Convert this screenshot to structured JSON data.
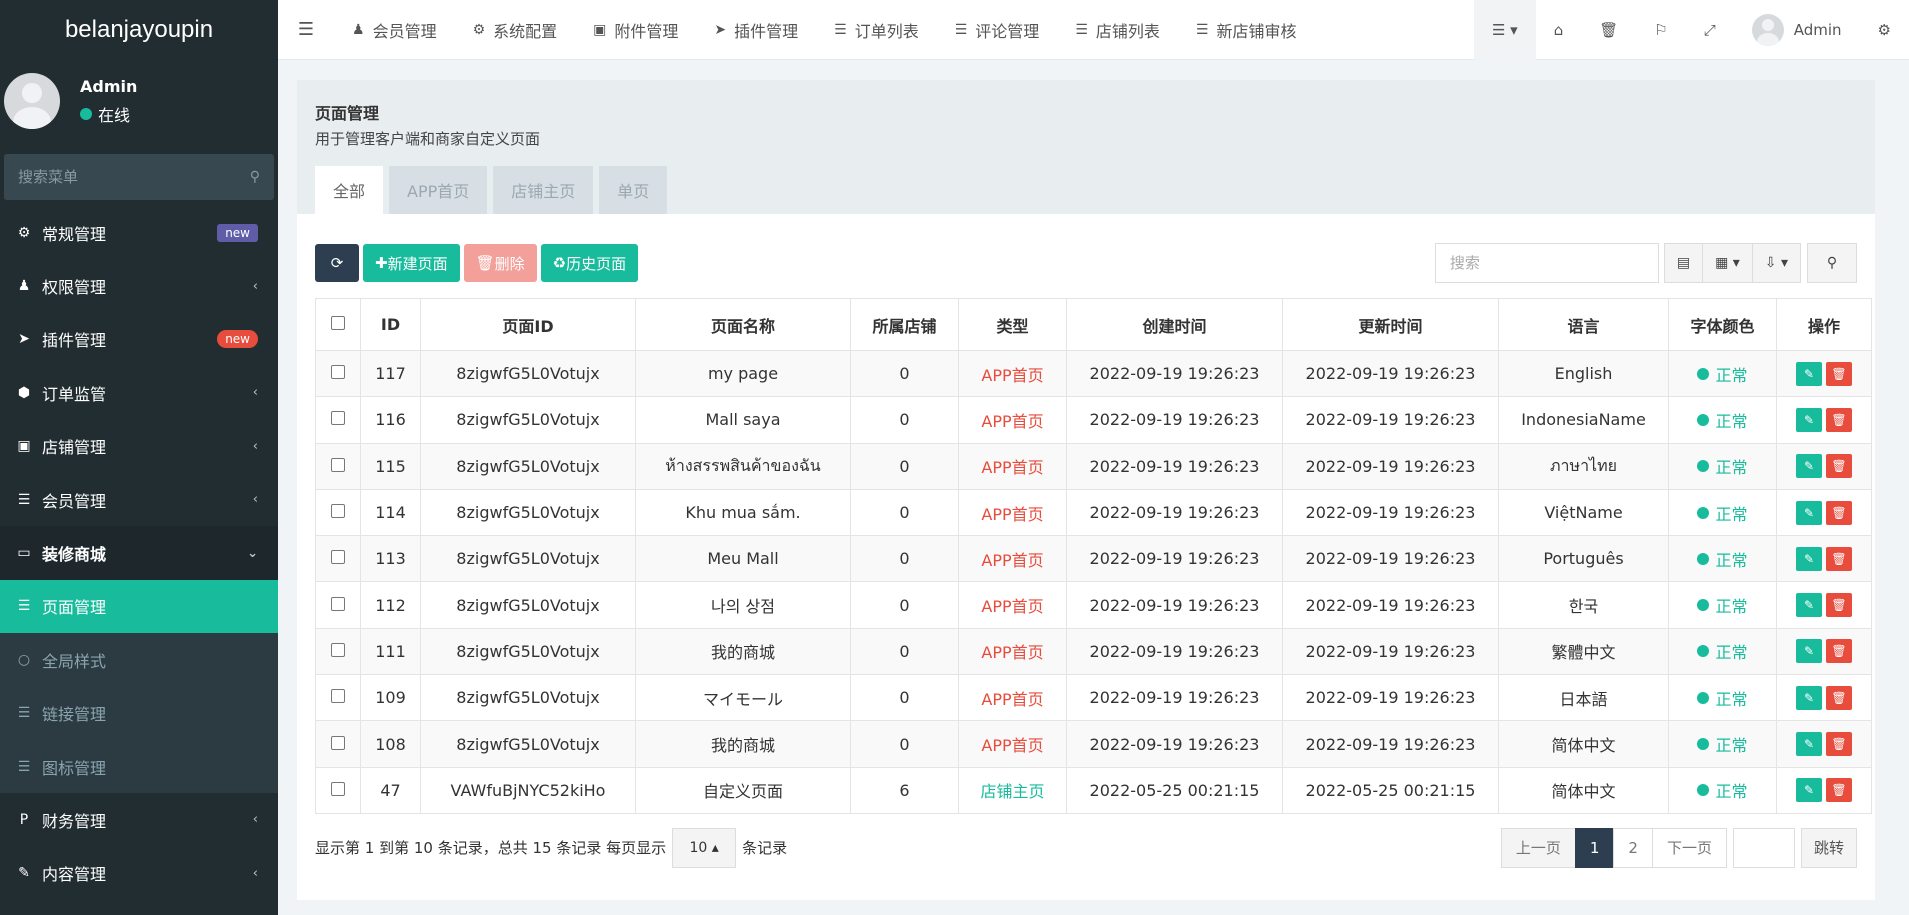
{
  "brand": "belanjayoupin",
  "user": {
    "name": "Admin",
    "status": "在线"
  },
  "sidebar": {
    "search_placeholder": "搜索菜单",
    "items": [
      {
        "label": "常规管理",
        "icon": "cogs-icon",
        "badge": "new"
      },
      {
        "label": "权限管理",
        "icon": "group-icon"
      },
      {
        "label": "插件管理",
        "icon": "rocket-icon",
        "badge": "new"
      },
      {
        "label": "订单监管",
        "icon": "cube-icon"
      },
      {
        "label": "店铺管理",
        "icon": "archive-icon"
      },
      {
        "label": "会员管理",
        "icon": "list-icon"
      },
      {
        "label": "装修商城",
        "icon": "desktop-icon"
      }
    ],
    "sub_items": [
      {
        "label": "页面管理",
        "icon": "list-icon"
      },
      {
        "label": "全局样式",
        "icon": "circle-icon"
      },
      {
        "label": "链接管理",
        "icon": "list-icon"
      },
      {
        "label": "图标管理",
        "icon": "list-icon"
      }
    ],
    "bottom_items": [
      {
        "label": "财务管理",
        "icon": "paypal-icon"
      },
      {
        "label": "内容管理",
        "icon": "edit-icon"
      }
    ]
  },
  "navbar": {
    "links": [
      {
        "label": "会员管理",
        "icon": "user-icon"
      },
      {
        "label": "系统配置",
        "icon": "cog-icon"
      },
      {
        "label": "附件管理",
        "icon": "image-icon"
      },
      {
        "label": "插件管理",
        "icon": "rocket-icon"
      },
      {
        "label": "订单列表",
        "icon": "list-icon"
      },
      {
        "label": "评论管理",
        "icon": "list-icon"
      },
      {
        "label": "店铺列表",
        "icon": "list-icon"
      },
      {
        "label": "新店铺审核",
        "icon": "list-icon"
      }
    ],
    "admin": "Admin"
  },
  "panel": {
    "title": "页面管理",
    "subtitle": "用于管理客户端和商家自定义页面",
    "tabs": [
      "全部",
      "APP首页",
      "店铺主页",
      "单页"
    ]
  },
  "toolbar": {
    "new_label": "新建页面",
    "delete_label": "删除",
    "history_label": "历史页面",
    "search_placeholder": "搜索"
  },
  "table": {
    "headers": [
      "ID",
      "页面ID",
      "页面名称",
      "所属店铺",
      "类型",
      "创建时间",
      "更新时间",
      "语言",
      "字体颜色",
      "操作"
    ],
    "rows": [
      {
        "id": "117",
        "page_id": "8zigwfG5L0Votujx",
        "name": "my page",
        "store": "0",
        "type": "APP首页",
        "created": "2022-09-19 19:26:23",
        "updated": "2022-09-19 19:26:23",
        "lang": "English",
        "color": "正常"
      },
      {
        "id": "116",
        "page_id": "8zigwfG5L0Votujx",
        "name": "Mall saya",
        "store": "0",
        "type": "APP首页",
        "created": "2022-09-19 19:26:23",
        "updated": "2022-09-19 19:26:23",
        "lang": "IndonesiaName",
        "color": "正常"
      },
      {
        "id": "115",
        "page_id": "8zigwfG5L0Votujx",
        "name": "ห้างสรรพสินค้าของฉัน",
        "store": "0",
        "type": "APP首页",
        "created": "2022-09-19 19:26:23",
        "updated": "2022-09-19 19:26:23",
        "lang": "ภาษาไทย",
        "color": "正常"
      },
      {
        "id": "114",
        "page_id": "8zigwfG5L0Votujx",
        "name": "Khu mua sắm.",
        "store": "0",
        "type": "APP首页",
        "created": "2022-09-19 19:26:23",
        "updated": "2022-09-19 19:26:23",
        "lang": "ViệtName",
        "color": "正常"
      },
      {
        "id": "113",
        "page_id": "8zigwfG5L0Votujx",
        "name": "Meu Mall",
        "store": "0",
        "type": "APP首页",
        "created": "2022-09-19 19:26:23",
        "updated": "2022-09-19 19:26:23",
        "lang": "Português",
        "color": "正常"
      },
      {
        "id": "112",
        "page_id": "8zigwfG5L0Votujx",
        "name": "나의 상점",
        "store": "0",
        "type": "APP首页",
        "created": "2022-09-19 19:26:23",
        "updated": "2022-09-19 19:26:23",
        "lang": "한국",
        "color": "正常"
      },
      {
        "id": "111",
        "page_id": "8zigwfG5L0Votujx",
        "name": "我的商城",
        "store": "0",
        "type": "APP首页",
        "created": "2022-09-19 19:26:23",
        "updated": "2022-09-19 19:26:23",
        "lang": "繁體中文",
        "color": "正常"
      },
      {
        "id": "109",
        "page_id": "8zigwfG5L0Votujx",
        "name": "マイモール",
        "store": "0",
        "type": "APP首页",
        "created": "2022-09-19 19:26:23",
        "updated": "2022-09-19 19:26:23",
        "lang": "日本語",
        "color": "正常"
      },
      {
        "id": "108",
        "page_id": "8zigwfG5L0Votujx",
        "name": "我的商城",
        "store": "0",
        "type": "APP首页",
        "created": "2022-09-19 19:26:23",
        "updated": "2022-09-19 19:26:23",
        "lang": "简体中文",
        "color": "正常"
      },
      {
        "id": "47",
        "page_id": "VAWfuBjNYC52kiHo",
        "name": "自定义页面",
        "store": "6",
        "type": "店铺主页",
        "created": "2022-05-25 00:21:15",
        "updated": "2022-05-25 00:21:15",
        "lang": "简体中文",
        "color": "正常"
      }
    ]
  },
  "pagination": {
    "info_prefix": "显示第 1 到第 10 条记录，总共 15 条记录 每页显示",
    "page_size": "10",
    "info_suffix": "条记录",
    "prev": "上一页",
    "pages": [
      "1",
      "2"
    ],
    "current": "1",
    "next": "下一页",
    "jump": "跳转"
  },
  "colors": {
    "accent": "#18bc9c",
    "sidebar": "#222d32",
    "danger": "#e74c3c",
    "dark": "#2c3e50"
  }
}
